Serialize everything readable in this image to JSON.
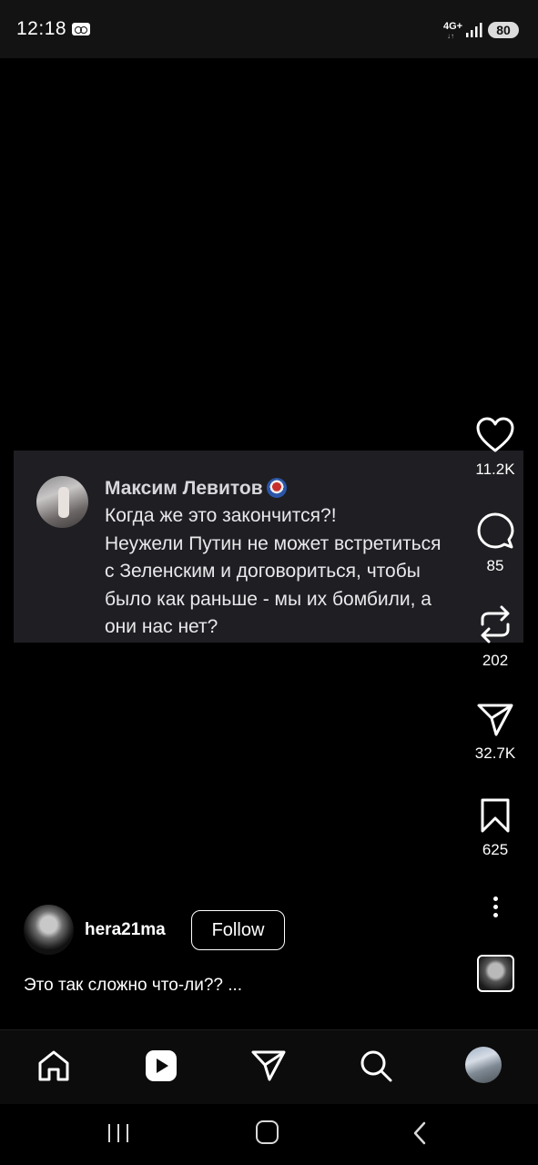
{
  "status_bar": {
    "time": "12:18",
    "network": "4G+",
    "battery": "80"
  },
  "comment": {
    "author": "Максим Левитов",
    "text": "Когда же это закончится?!\nНеужели Путин не может встретиться\nс Зеленским и договориться, чтобы\nбыло как раньше - мы их бомбили, а\nони нас нет?"
  },
  "actions": {
    "likes": "11.2K",
    "comments": "85",
    "reposts": "202",
    "shares": "32.7K",
    "saves": "625"
  },
  "post": {
    "username": "hera21ma",
    "follow_label": "Follow",
    "caption": "Это так сложно что-ли?? ..."
  },
  "icons": {
    "like": "heart-icon",
    "comment": "comment-bubble-icon",
    "repost": "repost-icon",
    "share": "send-icon",
    "save": "bookmark-icon",
    "more": "more-vertical-icon",
    "nav": [
      "home-icon",
      "reels-icon",
      "send-icon",
      "search-icon",
      "profile-avatar"
    ]
  },
  "colors": {
    "background": "#000000",
    "comment_card": "#1f1e22",
    "status_bar": "#131313"
  }
}
